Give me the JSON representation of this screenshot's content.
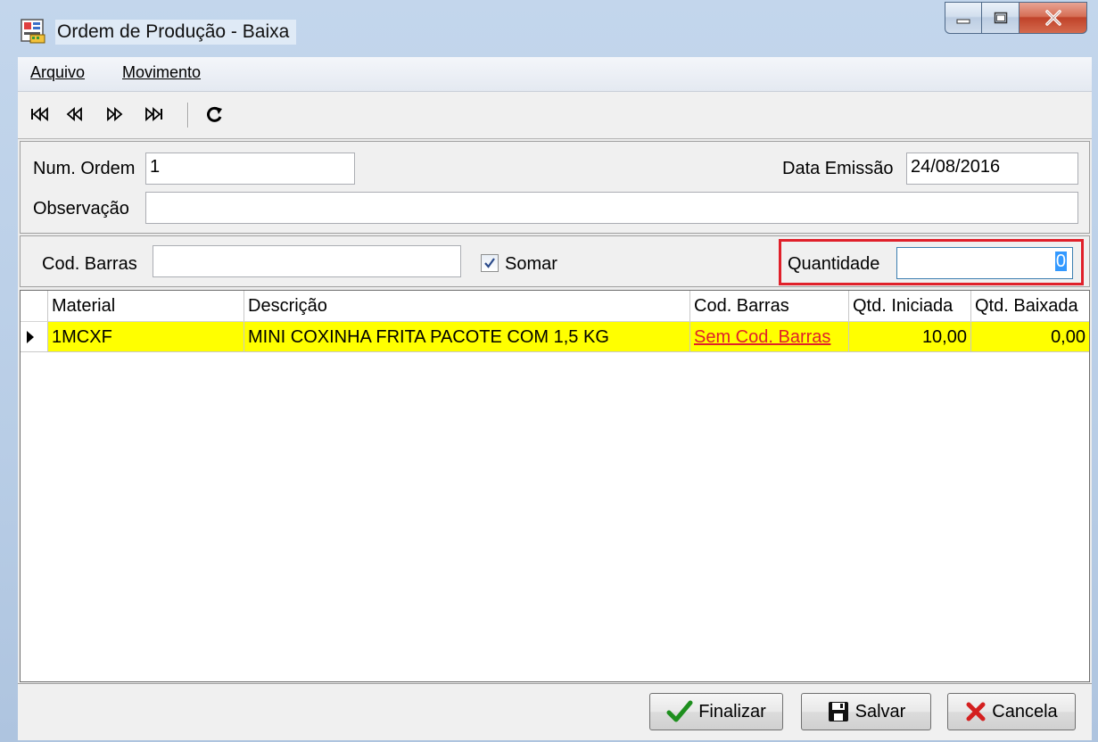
{
  "window": {
    "title": "Ordem de Produção - Baixa"
  },
  "menu": {
    "items": [
      "Arquivo",
      "Movimento"
    ]
  },
  "toolbar": {
    "buttons": [
      "first-record-icon",
      "previous-record-icon",
      "next-record-icon",
      "last-record-icon",
      "refresh-icon"
    ]
  },
  "header": {
    "num_ordem_label": "Num. Ordem",
    "num_ordem_value": "1",
    "data_emissao_label": "Data Emissão",
    "data_emissao_value": "24/08/2016",
    "observacao_label": "Observação",
    "observacao_value": ""
  },
  "entry": {
    "cod_barras_label": "Cod. Barras",
    "cod_barras_value": "",
    "somar_label": "Somar",
    "somar_checked": true,
    "quantidade_label": "Quantidade",
    "quantidade_value": "0"
  },
  "grid": {
    "columns": [
      "Material",
      "Descrição",
      "Cod. Barras",
      "Qtd. Iniciada",
      "Qtd. Baixada"
    ],
    "rows": [
      {
        "material": "1MCXF",
        "descricao": "MINI COXINHA FRITA PACOTE COM 1,5 KG",
        "cod_barras": "Sem Cod. Barras",
        "qtd_iniciada": "10,00",
        "qtd_baixada": "0,00"
      }
    ]
  },
  "actions": {
    "finalizar": "Finalizar",
    "salvar": "Salvar",
    "cancela": "Cancela"
  },
  "colors": {
    "row_highlight": "#ffff00",
    "link_red": "#e0202a",
    "focus_border": "#e0202a"
  }
}
